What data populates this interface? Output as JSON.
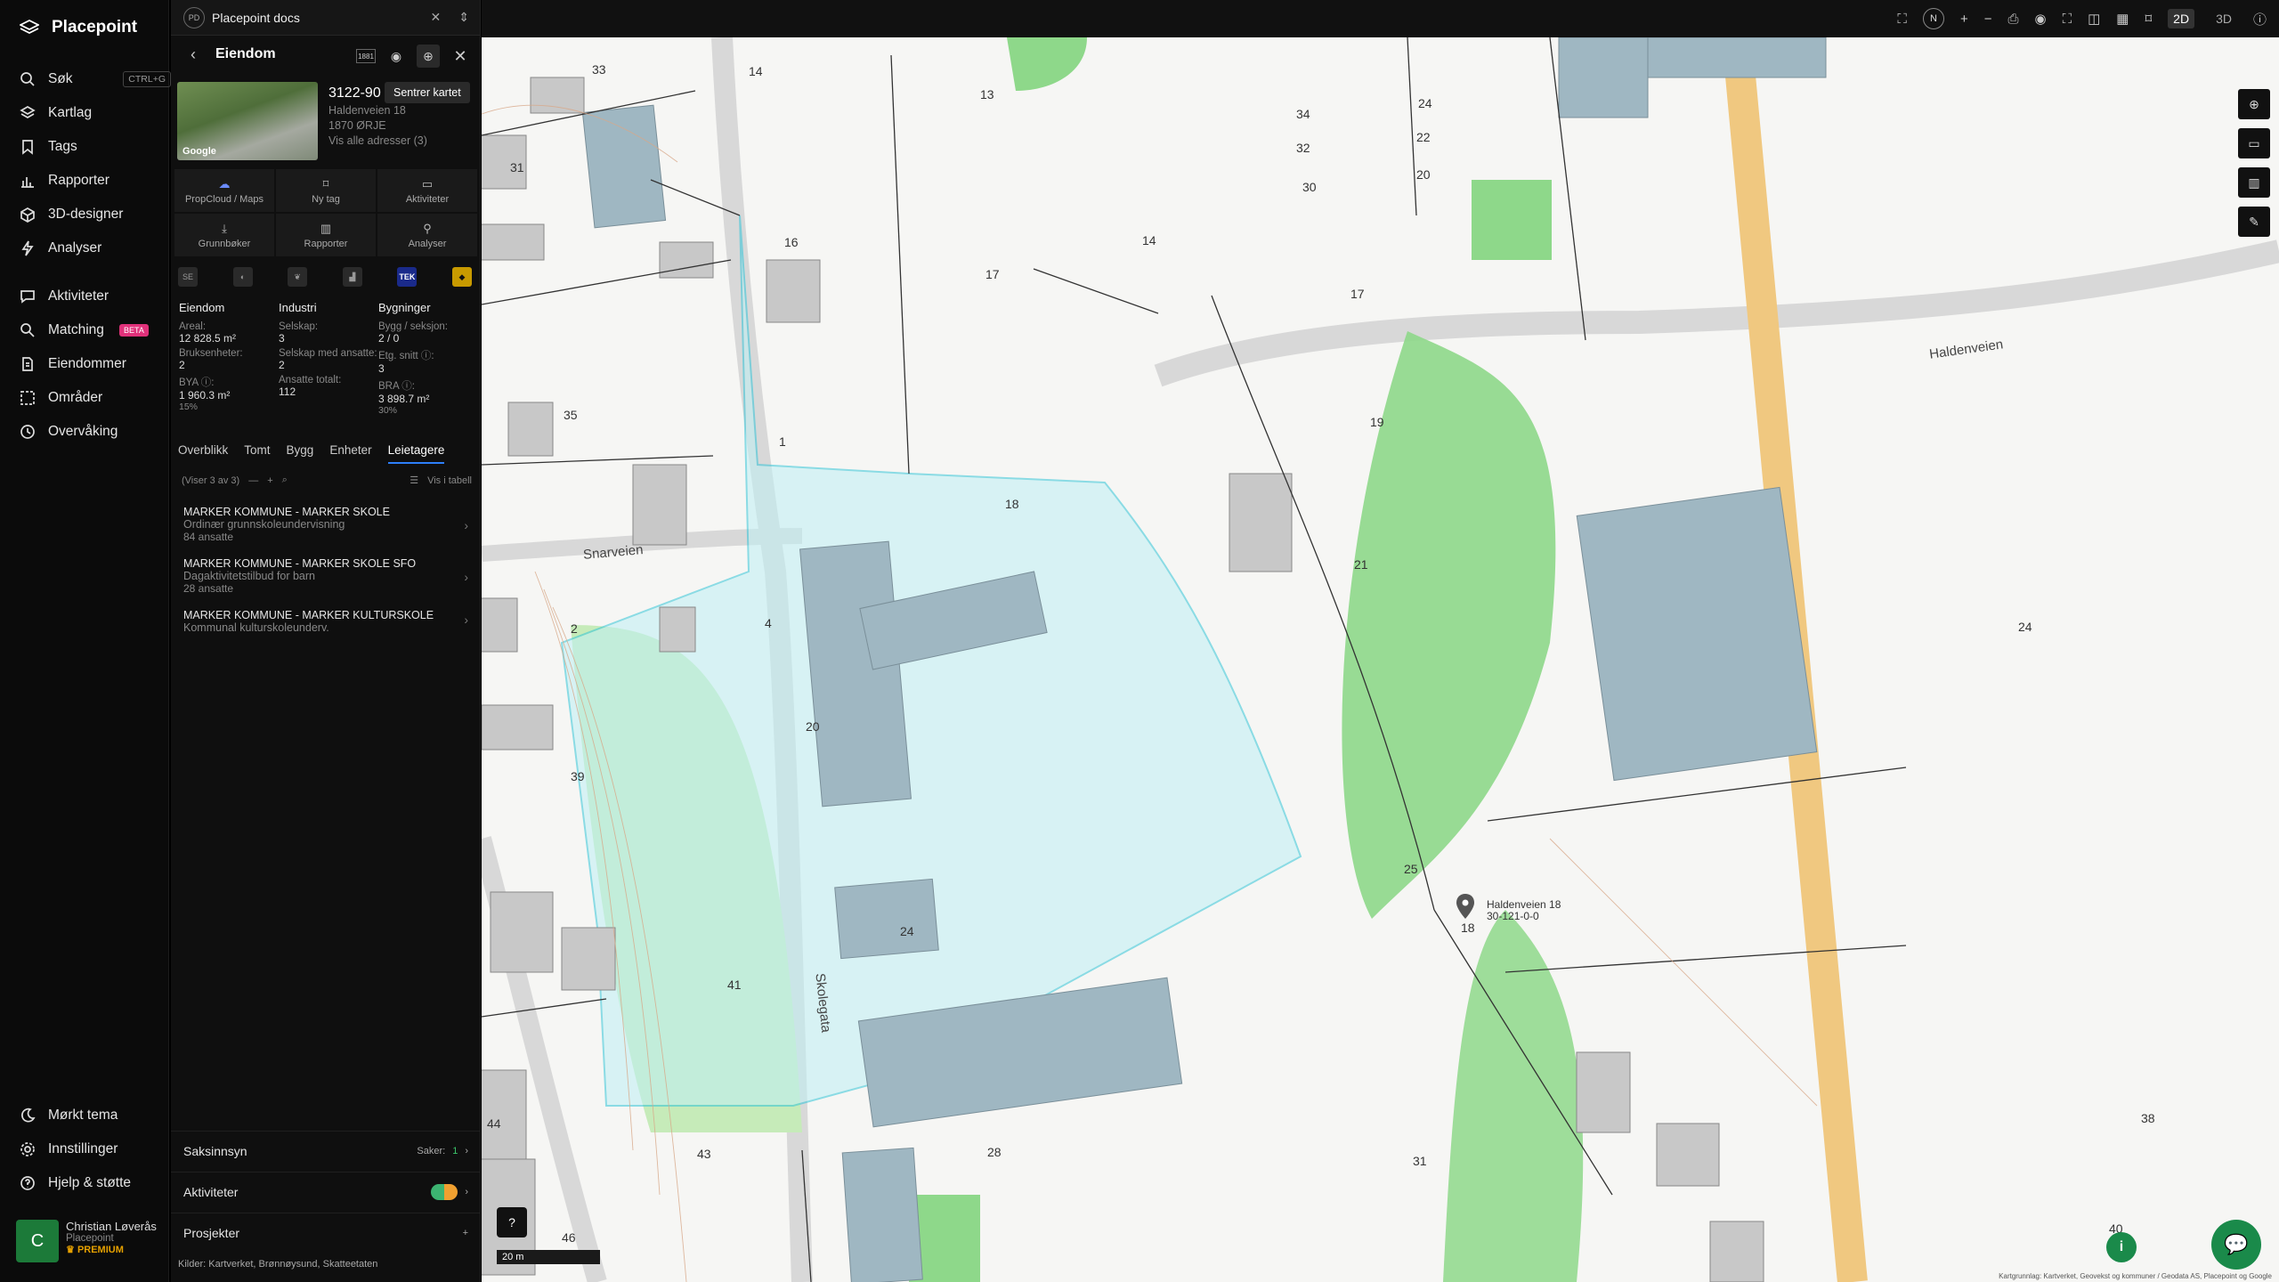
{
  "app": {
    "name": "Placepoint"
  },
  "nav": {
    "items": [
      {
        "label": "Søk",
        "kbd": "CTRL+G"
      },
      {
        "label": "Kartlag"
      },
      {
        "label": "Tags"
      },
      {
        "label": "Rapporter"
      },
      {
        "label": "3D-designer"
      },
      {
        "label": "Analyser"
      },
      {
        "label": "Aktiviteter"
      },
      {
        "label": "Matching",
        "badge": "BETA"
      },
      {
        "label": "Eiendommer"
      },
      {
        "label": "Områder"
      },
      {
        "label": "Overvåking"
      }
    ],
    "bottom": [
      {
        "label": "Mørkt tema"
      },
      {
        "label": "Innstillinger"
      },
      {
        "label": "Hjelp & støtte"
      }
    ],
    "user": {
      "initial": "C",
      "name": "Christian Løverås",
      "org": "Placepoint",
      "plan": "PREMIUM"
    }
  },
  "panel": {
    "tab": {
      "badge": "PD",
      "title": "Placepoint docs"
    },
    "header": {
      "title": "Eiendom",
      "tooltip": "Sentrer kartet"
    },
    "property": {
      "id": "3122-90",
      "address": "Haldenveien 18",
      "postal": "1870 ØRJE",
      "all_addresses": "Vis alle adresser (3)",
      "image_tag": "Google"
    },
    "actions": [
      {
        "label": "PropCloud / Maps"
      },
      {
        "label": "Ny tag"
      },
      {
        "label": "Aktiviteter"
      },
      {
        "label": "Grunnbøker"
      },
      {
        "label": "Rapporter"
      },
      {
        "label": "Analyser"
      }
    ],
    "providers": [
      "SE",
      "",
      "",
      "",
      "TEK",
      ""
    ],
    "stats": {
      "eiendom": {
        "h": "Eiendom",
        "l1": "Areal:",
        "v1": "12 828.5 m²",
        "l2": "Bruksenheter:",
        "v2": "2",
        "l3": "BYA ⓘ:",
        "v3": "1 960.3 m²",
        "p": "15%"
      },
      "industri": {
        "h": "Industri",
        "l1": "Selskap:",
        "v1": "3",
        "l2": "Selskap med ansatte:",
        "v2": "2",
        "l3": "Ansatte totalt:",
        "v3": "112"
      },
      "bygninger": {
        "h": "Bygninger",
        "l1": "Bygg / seksjon:",
        "v1": "2 / 0",
        "l2": "Etg. snitt ⓘ:",
        "v2": "3",
        "l3": "BRA ⓘ:",
        "v3": "3 898.7 m²",
        "p": "30%"
      }
    },
    "subtabs": [
      "Overblikk",
      "Tomt",
      "Bygg",
      "Enheter",
      "Leietagere"
    ],
    "list_meta": {
      "showing": "(Viser 3 av 3)",
      "table": "Vis i tabell"
    },
    "tenants": [
      {
        "name": "MARKER KOMMUNE - MARKER SKOLE",
        "desc": "Ordinær grunnskoleundervisning",
        "count": "84 ansatte"
      },
      {
        "name": "MARKER KOMMUNE - MARKER SKOLE SFO",
        "desc": "Dagaktivitetstilbud for barn",
        "count": "28 ansatte"
      },
      {
        "name": "MARKER KOMMUNE - MARKER KULTURSKOLE",
        "desc": "Kommunal kulturskoleunderv.",
        "count": ""
      }
    ],
    "accordions": {
      "saksinnsyn": {
        "label": "Saksinnsyn",
        "meta": "Saker:",
        "count": "1"
      },
      "aktiviteter": {
        "label": "Aktiviteter"
      },
      "prosjekter": {
        "label": "Prosjekter"
      }
    },
    "sources": {
      "prefix": "Kilder:",
      "list": "Kartverket, Brønnøysund, Skatteetaten"
    }
  },
  "map": {
    "view": {
      "mode_2d": "2D",
      "mode_3d": "3D",
      "north": "N"
    },
    "streets": [
      {
        "name": "Haldenveien"
      },
      {
        "name": "Snarveien"
      },
      {
        "name": "Skolegata"
      }
    ],
    "house_numbers": [
      "33",
      "14",
      "13",
      "31",
      "16",
      "17",
      "14",
      "34",
      "32",
      "30",
      "24",
      "22",
      "20",
      "17",
      "19",
      "35",
      "1",
      "18",
      "21",
      "24",
      "2",
      "4",
      "20",
      "39",
      "24",
      "41",
      "25",
      "18",
      "44",
      "43",
      "28",
      "31",
      "46",
      "38",
      "40"
    ],
    "pin": {
      "line1": "Haldenveien 18",
      "line2": "30-121-0-0"
    },
    "scale": "20 m",
    "attribution": "Kartgrunnlag: Kartverket, Geovekst og kommuner / Geodata AS, Placepoint og Google"
  },
  "colors": {
    "accent": "#2d7ff9",
    "parcel": "#33c5d8",
    "green": "#8ed88a",
    "building": "#9fb7c2",
    "brand_green": "#1a8a4a"
  }
}
